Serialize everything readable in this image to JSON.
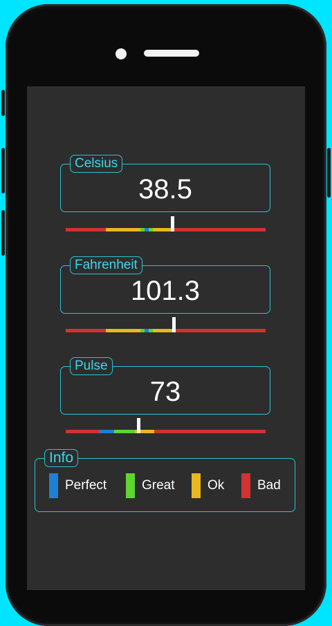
{
  "readings": [
    {
      "label": "Celsius",
      "value": "38.5",
      "scale_position": 0.535
    },
    {
      "label": "Fahrenheit",
      "value": "101.3",
      "scale_position": 0.54
    },
    {
      "label": "Pulse",
      "value": "73",
      "scale_position": 0.365
    }
  ],
  "info": {
    "title": "Info",
    "legend": [
      {
        "label": "Perfect",
        "color": "#1e7fd6"
      },
      {
        "label": "Great",
        "color": "#5ed62e"
      },
      {
        "label": "Ok",
        "color": "#e8b820"
      },
      {
        "label": "Bad",
        "color": "#d23232"
      }
    ]
  },
  "icons": [
    "front-camera-icon",
    "earpiece-speaker-icon"
  ]
}
